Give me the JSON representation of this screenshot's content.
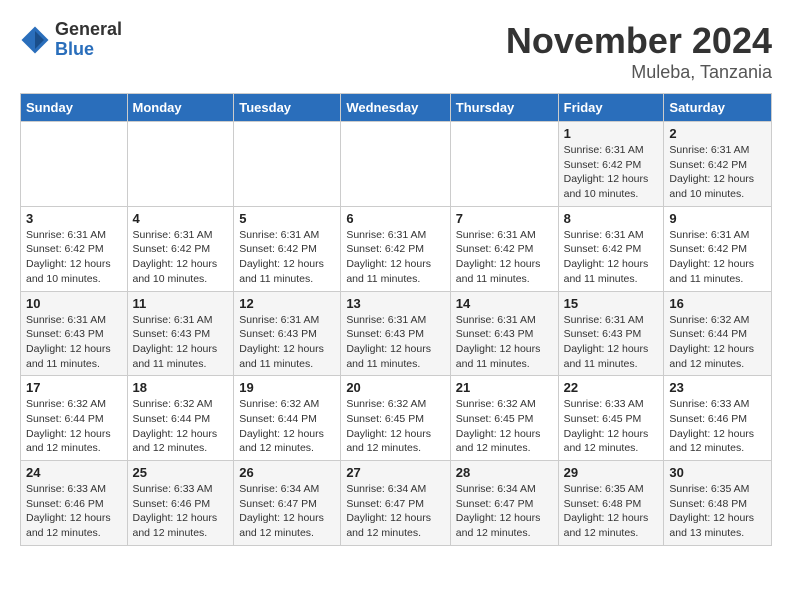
{
  "logo": {
    "general": "General",
    "blue": "Blue"
  },
  "title": {
    "month": "November 2024",
    "location": "Muleba, Tanzania"
  },
  "weekdays": [
    "Sunday",
    "Monday",
    "Tuesday",
    "Wednesday",
    "Thursday",
    "Friday",
    "Saturday"
  ],
  "weeks": [
    [
      {
        "day": "",
        "info": ""
      },
      {
        "day": "",
        "info": ""
      },
      {
        "day": "",
        "info": ""
      },
      {
        "day": "",
        "info": ""
      },
      {
        "day": "",
        "info": ""
      },
      {
        "day": "1",
        "info": "Sunrise: 6:31 AM\nSunset: 6:42 PM\nDaylight: 12 hours\nand 10 minutes."
      },
      {
        "day": "2",
        "info": "Sunrise: 6:31 AM\nSunset: 6:42 PM\nDaylight: 12 hours\nand 10 minutes."
      }
    ],
    [
      {
        "day": "3",
        "info": "Sunrise: 6:31 AM\nSunset: 6:42 PM\nDaylight: 12 hours\nand 10 minutes."
      },
      {
        "day": "4",
        "info": "Sunrise: 6:31 AM\nSunset: 6:42 PM\nDaylight: 12 hours\nand 10 minutes."
      },
      {
        "day": "5",
        "info": "Sunrise: 6:31 AM\nSunset: 6:42 PM\nDaylight: 12 hours\nand 11 minutes."
      },
      {
        "day": "6",
        "info": "Sunrise: 6:31 AM\nSunset: 6:42 PM\nDaylight: 12 hours\nand 11 minutes."
      },
      {
        "day": "7",
        "info": "Sunrise: 6:31 AM\nSunset: 6:42 PM\nDaylight: 12 hours\nand 11 minutes."
      },
      {
        "day": "8",
        "info": "Sunrise: 6:31 AM\nSunset: 6:42 PM\nDaylight: 12 hours\nand 11 minutes."
      },
      {
        "day": "9",
        "info": "Sunrise: 6:31 AM\nSunset: 6:42 PM\nDaylight: 12 hours\nand 11 minutes."
      }
    ],
    [
      {
        "day": "10",
        "info": "Sunrise: 6:31 AM\nSunset: 6:43 PM\nDaylight: 12 hours\nand 11 minutes."
      },
      {
        "day": "11",
        "info": "Sunrise: 6:31 AM\nSunset: 6:43 PM\nDaylight: 12 hours\nand 11 minutes."
      },
      {
        "day": "12",
        "info": "Sunrise: 6:31 AM\nSunset: 6:43 PM\nDaylight: 12 hours\nand 11 minutes."
      },
      {
        "day": "13",
        "info": "Sunrise: 6:31 AM\nSunset: 6:43 PM\nDaylight: 12 hours\nand 11 minutes."
      },
      {
        "day": "14",
        "info": "Sunrise: 6:31 AM\nSunset: 6:43 PM\nDaylight: 12 hours\nand 11 minutes."
      },
      {
        "day": "15",
        "info": "Sunrise: 6:31 AM\nSunset: 6:43 PM\nDaylight: 12 hours\nand 11 minutes."
      },
      {
        "day": "16",
        "info": "Sunrise: 6:32 AM\nSunset: 6:44 PM\nDaylight: 12 hours\nand 12 minutes."
      }
    ],
    [
      {
        "day": "17",
        "info": "Sunrise: 6:32 AM\nSunset: 6:44 PM\nDaylight: 12 hours\nand 12 minutes."
      },
      {
        "day": "18",
        "info": "Sunrise: 6:32 AM\nSunset: 6:44 PM\nDaylight: 12 hours\nand 12 minutes."
      },
      {
        "day": "19",
        "info": "Sunrise: 6:32 AM\nSunset: 6:44 PM\nDaylight: 12 hours\nand 12 minutes."
      },
      {
        "day": "20",
        "info": "Sunrise: 6:32 AM\nSunset: 6:45 PM\nDaylight: 12 hours\nand 12 minutes."
      },
      {
        "day": "21",
        "info": "Sunrise: 6:32 AM\nSunset: 6:45 PM\nDaylight: 12 hours\nand 12 minutes."
      },
      {
        "day": "22",
        "info": "Sunrise: 6:33 AM\nSunset: 6:45 PM\nDaylight: 12 hours\nand 12 minutes."
      },
      {
        "day": "23",
        "info": "Sunrise: 6:33 AM\nSunset: 6:46 PM\nDaylight: 12 hours\nand 12 minutes."
      }
    ],
    [
      {
        "day": "24",
        "info": "Sunrise: 6:33 AM\nSunset: 6:46 PM\nDaylight: 12 hours\nand 12 minutes."
      },
      {
        "day": "25",
        "info": "Sunrise: 6:33 AM\nSunset: 6:46 PM\nDaylight: 12 hours\nand 12 minutes."
      },
      {
        "day": "26",
        "info": "Sunrise: 6:34 AM\nSunset: 6:47 PM\nDaylight: 12 hours\nand 12 minutes."
      },
      {
        "day": "27",
        "info": "Sunrise: 6:34 AM\nSunset: 6:47 PM\nDaylight: 12 hours\nand 12 minutes."
      },
      {
        "day": "28",
        "info": "Sunrise: 6:34 AM\nSunset: 6:47 PM\nDaylight: 12 hours\nand 12 minutes."
      },
      {
        "day": "29",
        "info": "Sunrise: 6:35 AM\nSunset: 6:48 PM\nDaylight: 12 hours\nand 12 minutes."
      },
      {
        "day": "30",
        "info": "Sunrise: 6:35 AM\nSunset: 6:48 PM\nDaylight: 12 hours\nand 13 minutes."
      }
    ]
  ]
}
